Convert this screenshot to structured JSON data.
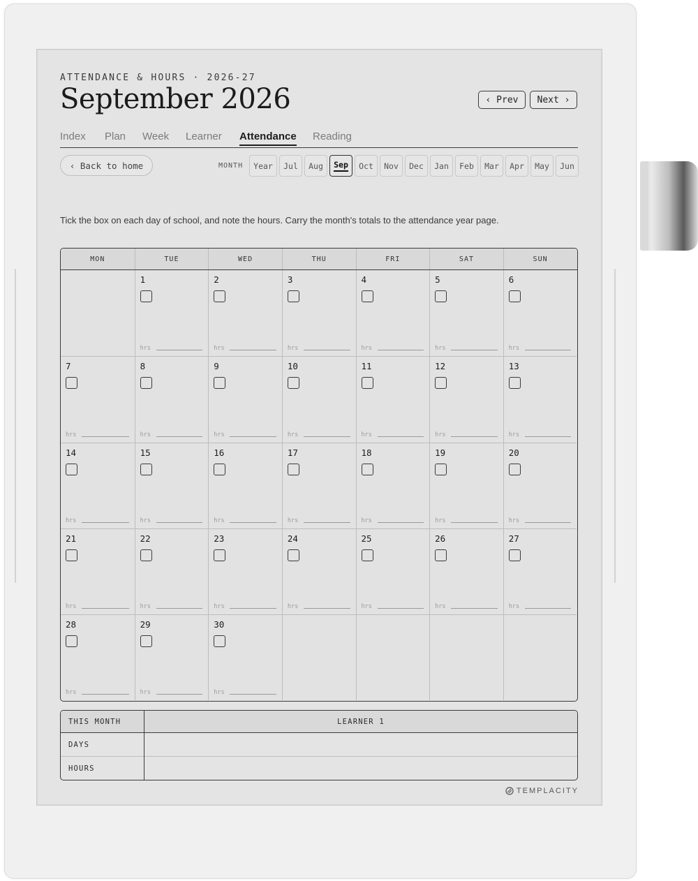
{
  "header": {
    "eyebrow": "ATTENDANCE & HOURS · 2026-27",
    "title": "September 2026",
    "prev_label": "‹ Prev",
    "next_label": "Next ›"
  },
  "tabs": [
    {
      "label": "Index",
      "active": false
    },
    {
      "label": "Plan",
      "active": false
    },
    {
      "label": "Week",
      "active": false
    },
    {
      "label": "Learner",
      "active": false
    },
    {
      "label": "Attendance",
      "active": true
    },
    {
      "label": "Reading",
      "active": false
    }
  ],
  "back_label": "‹ Back to home",
  "month_nav": {
    "label": "MONTH",
    "items": [
      "Year",
      "Jul",
      "Aug",
      "Sep",
      "Oct",
      "Nov",
      "Dec",
      "Jan",
      "Feb",
      "Mar",
      "Apr",
      "May",
      "Jun"
    ],
    "active": "Sep"
  },
  "instructions": "Tick the box on each day of school, and note the hours. Carry the month's totals to the attendance year page.",
  "calendar": {
    "weekdays": [
      "MON",
      "TUE",
      "WED",
      "THU",
      "FRI",
      "SAT",
      "SUN"
    ],
    "hrs_label": "hrs",
    "weeks": [
      [
        "",
        "1",
        "2",
        "3",
        "4",
        "5",
        "6"
      ],
      [
        "7",
        "8",
        "9",
        "10",
        "11",
        "12",
        "13"
      ],
      [
        "14",
        "15",
        "16",
        "17",
        "18",
        "19",
        "20"
      ],
      [
        "21",
        "22",
        "23",
        "24",
        "25",
        "26",
        "27"
      ],
      [
        "28",
        "29",
        "30",
        "",
        "",
        "",
        ""
      ]
    ]
  },
  "summary": {
    "header_label": "THIS MONTH",
    "learner": "LEARNER 1",
    "rows": [
      "DAYS",
      "HOURS"
    ]
  },
  "brand": "TEMPLACITY"
}
